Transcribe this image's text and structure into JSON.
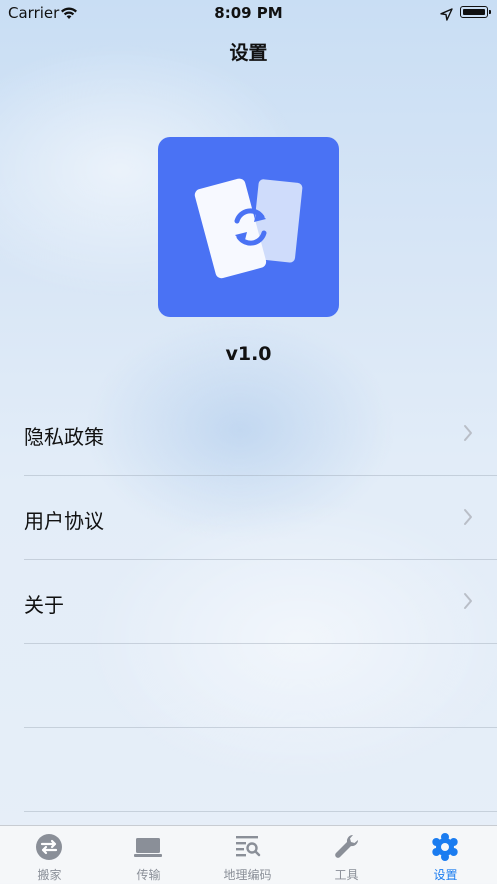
{
  "status_bar": {
    "carrier": "Carrier",
    "time": "8:09 PM",
    "icons": [
      "wifi-icon",
      "location-arrow-icon",
      "battery-icon"
    ]
  },
  "nav": {
    "title": "设置"
  },
  "app": {
    "icon": "swap-cards-icon",
    "version": "v1.0",
    "icon_color": "#4a72f4"
  },
  "menu": {
    "items": [
      {
        "label": "隐私政策",
        "icon": "chevron-right-icon"
      },
      {
        "label": "用户协议",
        "icon": "chevron-right-icon"
      },
      {
        "label": "关于",
        "icon": "chevron-right-icon"
      }
    ]
  },
  "tab_bar": {
    "tabs": [
      {
        "label": "搬家",
        "icon": "swap-circle-icon",
        "active": false
      },
      {
        "label": "传输",
        "icon": "laptop-icon",
        "active": false
      },
      {
        "label": "地理编码",
        "icon": "search-list-icon",
        "active": false
      },
      {
        "label": "工具",
        "icon": "wrench-icon",
        "active": false
      },
      {
        "label": "设置",
        "icon": "gear-icon",
        "active": true
      }
    ],
    "active_color": "#1a7cf0",
    "inactive_color": "#8a8f98"
  }
}
